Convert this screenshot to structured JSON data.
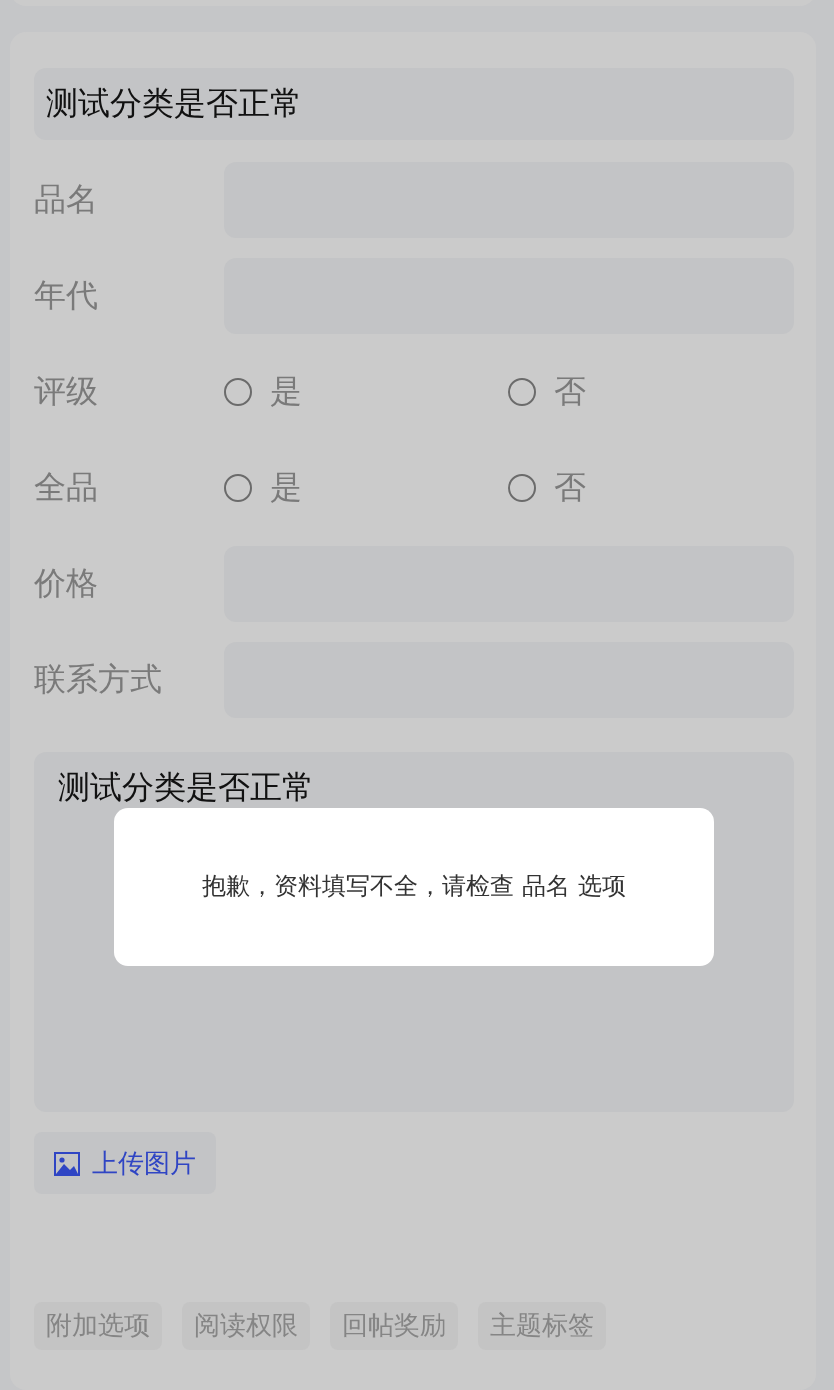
{
  "title_field": {
    "value": "测试分类是否正常"
  },
  "fields": [
    {
      "kind": "text",
      "label": "品名"
    },
    {
      "kind": "text",
      "label": "年代"
    },
    {
      "kind": "radio",
      "label": "评级",
      "options": [
        {
          "label": "是",
          "selected": false
        },
        {
          "label": "否",
          "selected": false
        }
      ]
    },
    {
      "kind": "radio",
      "label": "全品",
      "options": [
        {
          "label": "是",
          "selected": false
        },
        {
          "label": "否",
          "selected": false
        }
      ]
    },
    {
      "kind": "text",
      "label": "价格"
    },
    {
      "kind": "text",
      "label": "联系方式"
    }
  ],
  "content_field": {
    "value": "测试分类是否正常"
  },
  "upload_button": {
    "label": "上传图片"
  },
  "tabs": [
    {
      "label": "附加选项"
    },
    {
      "label": "阅读权限"
    },
    {
      "label": "回帖奖励"
    },
    {
      "label": "主题标签"
    }
  ],
  "dialog": {
    "message": "抱歉，资料填写不全，请检查 品名 选项"
  }
}
